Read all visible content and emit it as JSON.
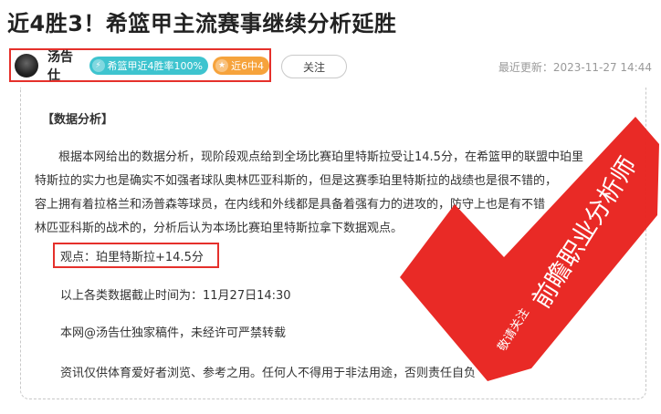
{
  "article": {
    "title": "近4胜3！希篮甲主流赛事继续分析延胜"
  },
  "author": {
    "name": "汤告仕",
    "badge_streak": "希篮甲近4胜率100%",
    "badge_record": "近6中4",
    "follow_label": "关注",
    "update_label": "最近更新：2023-11-27 14:44"
  },
  "content": {
    "section_title": "【数据分析】",
    "para_lines": [
      "根据本网给出的数据分析，现阶段观点给到全场比赛珀里特斯拉受让14.5分，在希篮甲的联盟中珀里",
      "特斯拉的实力也是确实不如强者球队奥林匹亚科斯的，但是这赛季珀里特斯拉的战绩也是很不错的，",
      "容上拥有着拉格兰和汤普森等球员，在内线和外线都是具备着强有力的进攻的，防守上也是有不错",
      "林匹亚科斯的战术的，分析后认为本场比赛珀里特斯拉拿下数据观点。"
    ],
    "view_point": "观点：珀里特斯拉+14.5分",
    "data_cutoff": "以上各类数据截止时间为：11月27日14:30",
    "copyright": "本网@汤告仕独家稿件，未经许可严禁转载",
    "disclaimer": "资讯仅供体育爱好者浏览、参考之用。任何人不得用于非法用途，否则责任自负"
  },
  "watermark": {
    "small_text": "敬请关注",
    "big_text": "前瞻职业分析师",
    "color": "#e8231f"
  },
  "colors": {
    "highlight_border": "#e5302b",
    "badge_teal": "#3ec4cf",
    "badge_orange": "#f6a33c"
  }
}
